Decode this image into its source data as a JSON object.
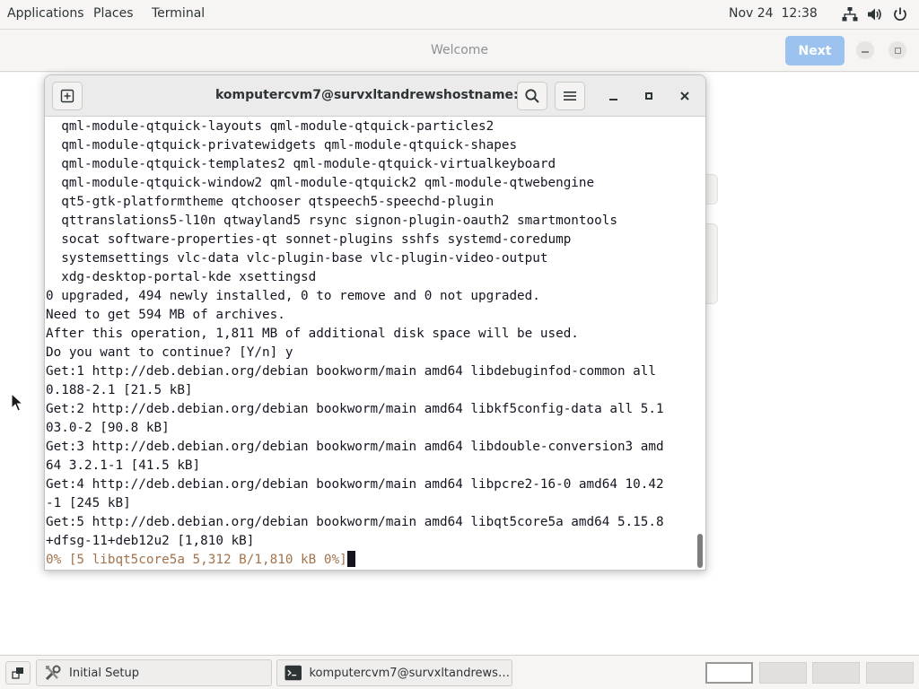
{
  "top_panel": {
    "applications": "Applications",
    "places": "Places",
    "terminal": "Terminal",
    "clock": "Nov 24  12:38",
    "tray_icons": [
      "network-icon",
      "volume-icon",
      "power-icon"
    ]
  },
  "welcome_window": {
    "title": "Welcome",
    "next_label": "Next"
  },
  "terminal_window": {
    "title": "komputercvm7@survxltandrewshostname: ~",
    "lines": [
      "  qml-module-qtquick-layouts qml-module-qtquick-particles2",
      "  qml-module-qtquick-privatewidgets qml-module-qtquick-shapes",
      "  qml-module-qtquick-templates2 qml-module-qtquick-virtualkeyboard",
      "  qml-module-qtquick-window2 qml-module-qtquick2 qml-module-qtwebengine",
      "  qt5-gtk-platformtheme qtchooser qtspeech5-speechd-plugin",
      "  qttranslations5-l10n qtwayland5 rsync signon-plugin-oauth2 smartmontools",
      "  socat software-properties-qt sonnet-plugins sshfs systemd-coredump",
      "  systemsettings vlc-data vlc-plugin-base vlc-plugin-video-output",
      "  xdg-desktop-portal-kde xsettingsd",
      "0 upgraded, 494 newly installed, 0 to remove and 0 not upgraded.",
      "Need to get 594 MB of archives.",
      "After this operation, 1,811 MB of additional disk space will be used.",
      "Do you want to continue? [Y/n] y",
      "Get:1 http://deb.debian.org/debian bookworm/main amd64 libdebuginfod-common all",
      "0.188-2.1 [21.5 kB]",
      "Get:2 http://deb.debian.org/debian bookworm/main amd64 libkf5config-data all 5.1",
      "03.0-2 [90.8 kB]",
      "Get:3 http://deb.debian.org/debian bookworm/main amd64 libdouble-conversion3 amd",
      "64 3.2.1-1 [41.5 kB]",
      "Get:4 http://deb.debian.org/debian bookworm/main amd64 libpcre2-16-0 amd64 10.42",
      "-1 [245 kB]",
      "Get:5 http://deb.debian.org/debian bookworm/main amd64 libqt5core5a amd64 5.15.8",
      "+dfsg-11+deb12u2 [1,810 kB]"
    ],
    "progress_line": "0% [5 libqt5core5a 5,312 B/1,810 kB 0%]"
  },
  "taskbar": {
    "tasks": [
      {
        "label": "Initial Setup",
        "icon": "tools-icon"
      },
      {
        "label": "komputercvm7@survxltandrewsh…",
        "icon": "terminal-icon"
      }
    ],
    "workspaces": 4,
    "active_workspace": 1
  }
}
